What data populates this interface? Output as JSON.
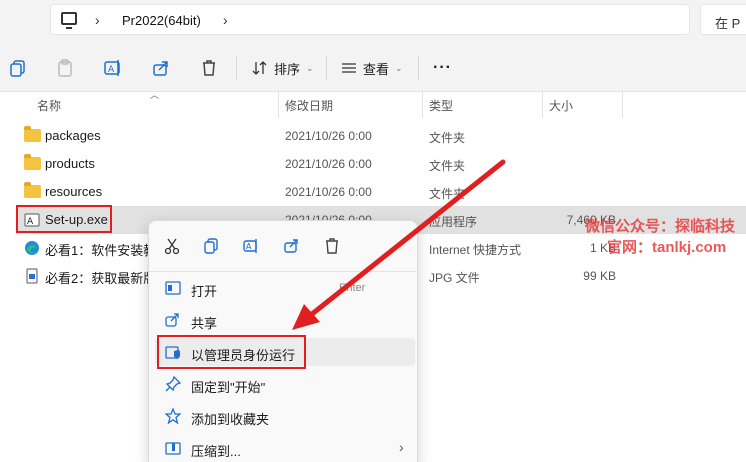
{
  "address": {
    "crumb": "Pr2022(64bit)",
    "search_partial": "在 P"
  },
  "toolbar": {
    "sort_label": "排序",
    "view_label": "查看",
    "more_label": "···"
  },
  "columns": {
    "name": "名称",
    "date": "修改日期",
    "type": "类型",
    "size": "大小"
  },
  "rows": [
    {
      "name": "packages",
      "date": "2021/10/26 0:00",
      "type": "文件夹",
      "size": ""
    },
    {
      "name": "products",
      "date": "2021/10/26 0:00",
      "type": "文件夹",
      "size": ""
    },
    {
      "name": "resources",
      "date": "2021/10/26 0:00",
      "type": "文件夹",
      "size": ""
    },
    {
      "name": "Set-up.exe",
      "date": "2021/10/26 0:00",
      "type": "应用程序",
      "size": "7,460 KB"
    },
    {
      "name": "必看1：软件安装教",
      "date": "",
      "type": "Internet 快捷方式",
      "size": "1 KB"
    },
    {
      "name": "必看2：获取最新版",
      "date": "",
      "type": "JPG 文件",
      "size": "99 KB"
    }
  ],
  "context_menu": {
    "items": [
      {
        "label": "打开",
        "shortcut": "Enter"
      },
      {
        "label": "共享",
        "shortcut": ""
      },
      {
        "label": "以管理员身份运行",
        "shortcut": ""
      },
      {
        "label": "固定到\"开始\"",
        "shortcut": ""
      },
      {
        "label": "添加到收藏夹",
        "shortcut": ""
      },
      {
        "label": "压缩到...",
        "shortcut": ""
      }
    ]
  },
  "watermark": {
    "line1": "微信公众号：探临科技",
    "line2": "官网：tanlkj.com"
  },
  "colors": {
    "highlight_red": "#e02020",
    "selected_row": "#e1e1e1",
    "folder_yellow": "#f5c242"
  }
}
